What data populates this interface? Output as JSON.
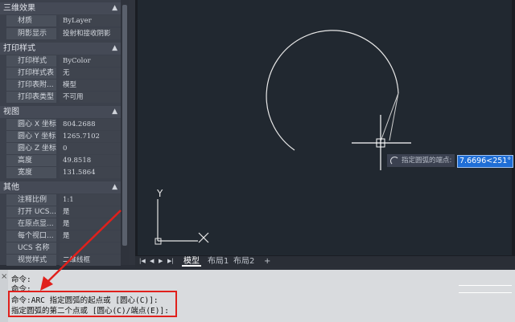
{
  "properties": {
    "sections": [
      {
        "title": "三维效果",
        "toggle": "▲",
        "rows": [
          {
            "key": "材质",
            "value": "ByLayer"
          },
          {
            "key": "阴影显示",
            "value": "投射和接收阴影"
          }
        ]
      },
      {
        "title": "打印样式",
        "toggle": "▲",
        "rows": [
          {
            "key": "打印样式",
            "value": "ByColor"
          },
          {
            "key": "打印样式表",
            "value": "无"
          },
          {
            "key": "打印表附...",
            "value": "模型"
          },
          {
            "key": "打印表类型",
            "value": "不可用"
          }
        ]
      },
      {
        "title": "视图",
        "toggle": "▲",
        "rows": [
          {
            "key": "圆心 X 坐标",
            "value": "804.2688"
          },
          {
            "key": "圆心 Y 坐标",
            "value": "1265.7102"
          },
          {
            "key": "圆心 Z 坐标",
            "value": "0"
          },
          {
            "key": "高度",
            "value": "49.8518"
          },
          {
            "key": "宽度",
            "value": "131.5864"
          }
        ]
      },
      {
        "title": "其他",
        "toggle": "▲",
        "rows": [
          {
            "key": "注释比例",
            "value": "1:1"
          },
          {
            "key": "打开 UCS...",
            "value": "是"
          },
          {
            "key": "在原点显...",
            "value": "是"
          },
          {
            "key": "每个视口...",
            "value": "是"
          },
          {
            "key": "UCS 名称",
            "value": ""
          },
          {
            "key": "视觉样式",
            "value": "二维线框"
          }
        ]
      }
    ]
  },
  "canvas": {
    "ucs_y_label": "Y",
    "ucs_x_label": "X",
    "dynamic_prompt": "指定圆弧的端点:",
    "dynamic_input": "7.6696<251°"
  },
  "tabs": {
    "nav": [
      "|◀",
      "◀",
      "▶",
      "▶|"
    ],
    "items": [
      {
        "label": "模型",
        "active": true
      },
      {
        "label": "布局1",
        "active": false
      },
      {
        "label": "布局2",
        "active": false
      },
      {
        "label": "+",
        "active": false
      }
    ]
  },
  "command": {
    "close_glyph": "×",
    "lines": [
      "命令:",
      "命令:",
      "命令:ARC 指定圆弧的起点或 [圆心(C)]:",
      "指定圆弧的第二个点或 [圆心(C)/端点(E)]:"
    ]
  },
  "colors": {
    "annotation_red": "#e0201c",
    "highlight_blue": "#1f6ed6",
    "canvas_bg": "#212830"
  }
}
